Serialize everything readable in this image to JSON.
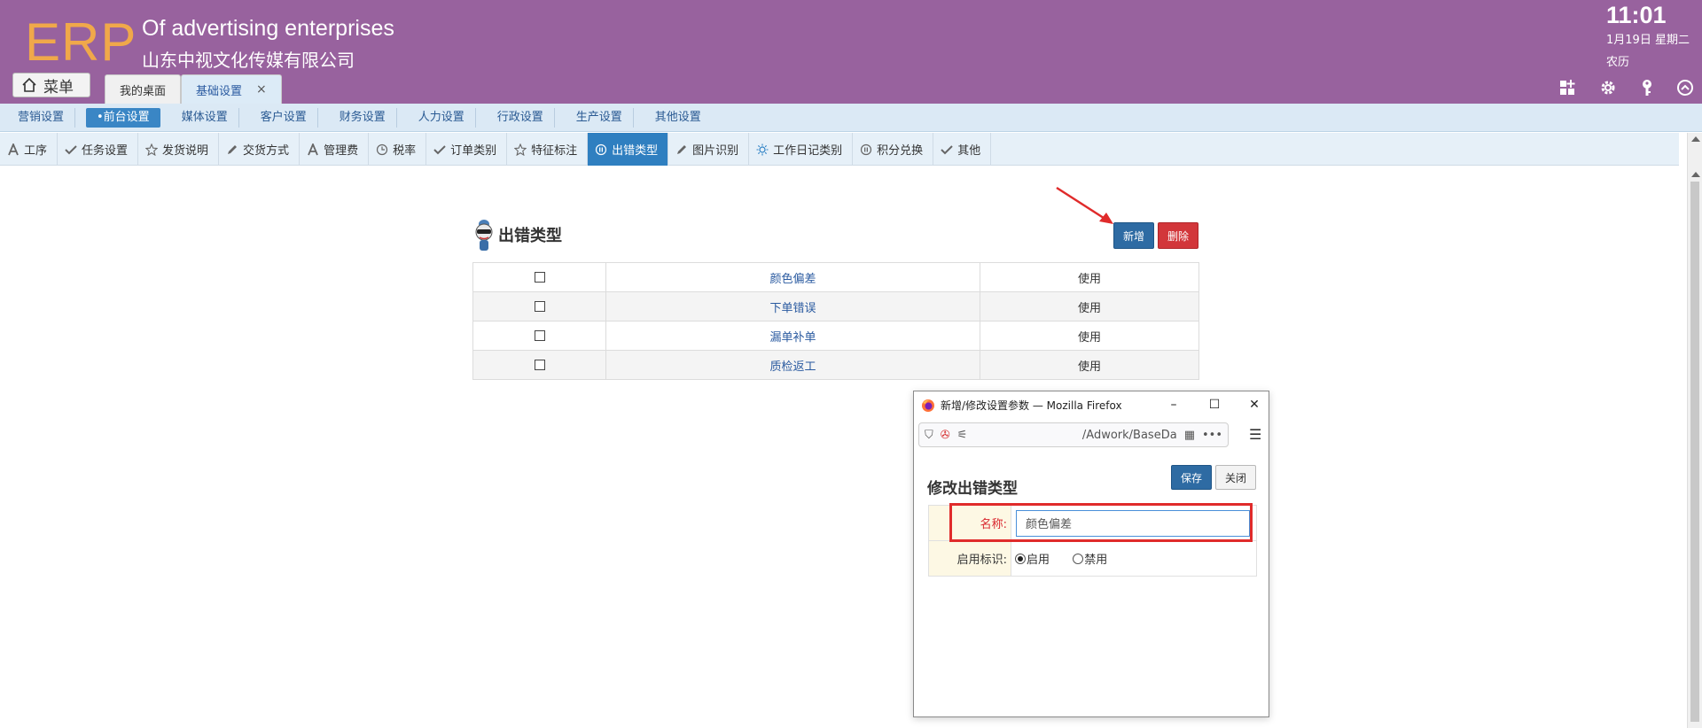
{
  "header": {
    "logo": "ERP",
    "title_en": "Of advertising enterprises",
    "title_cn": "山东中视文化传媒有限公司",
    "time": "11:01",
    "date": "1月19日 星期二",
    "lunar": "农历",
    "menu_label": "菜单",
    "tabs": [
      {
        "label": "我的桌面"
      },
      {
        "label": "基础设置",
        "close": "×"
      }
    ]
  },
  "nav2": {
    "items": [
      "营销设置",
      "•前台设置",
      "媒体设置",
      "客户设置",
      "财务设置",
      "人力设置",
      "行政设置",
      "生产设置",
      "其他设置"
    ]
  },
  "nav3": {
    "items": [
      "工序",
      "任务设置",
      "发货说明",
      "交货方式",
      "管理费",
      "税率",
      "订单类别",
      "特征标注",
      "出错类型",
      "图片识别",
      "工作日记类别",
      "积分兑换",
      "其他"
    ]
  },
  "panel": {
    "title": "出错类型",
    "add_label": "新增",
    "delete_label": "删除",
    "rows": [
      {
        "name": "颜色偏差",
        "status": "使用"
      },
      {
        "name": "下单错误",
        "status": "使用"
      },
      {
        "name": "漏单补单",
        "status": "使用"
      },
      {
        "name": "质检返工",
        "status": "使用"
      }
    ]
  },
  "popup": {
    "window_title": "新增/修改设置参数 — Mozilla Firefox",
    "url": "/Adwork/BaseDa",
    "heading": "修改出错类型",
    "save_label": "保存",
    "close_label": "关闭",
    "name_label": "名称:",
    "name_value": "颜色偏差",
    "flag_label": "启用标识:",
    "enable_label": "启用",
    "disable_label": "禁用"
  },
  "colors": {
    "header_bg": "#98629e",
    "logo": "#f0a84a",
    "active_tab": "#2f7fc0",
    "primary_button": "#2e6ba3",
    "danger_button": "#d2363a"
  }
}
